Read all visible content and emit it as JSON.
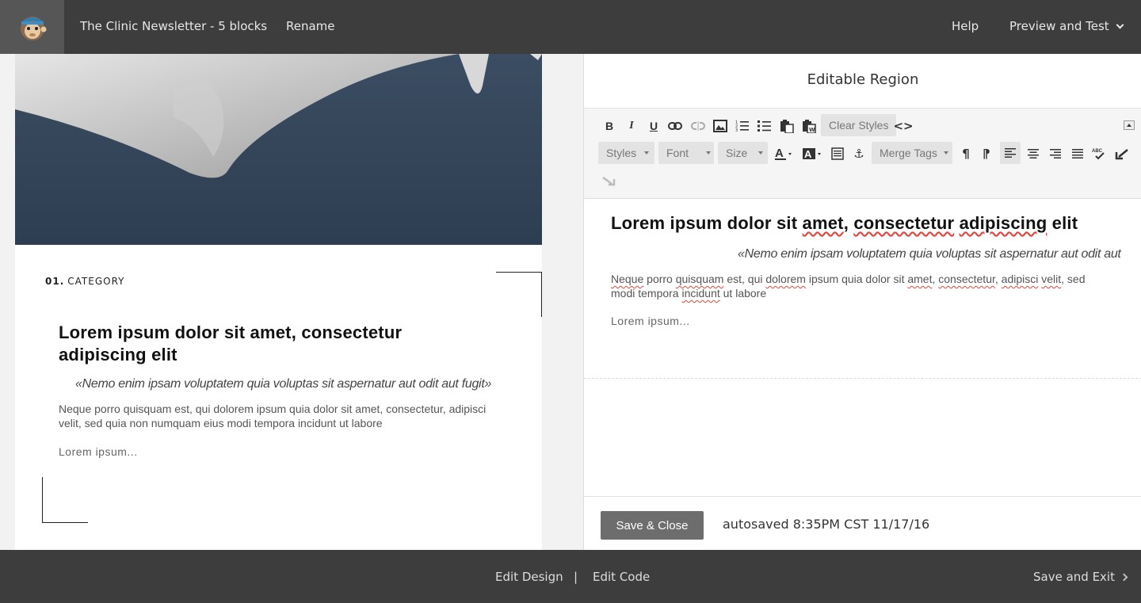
{
  "topbar": {
    "title": "The Clinic Newsletter - 5 blocks",
    "rename": "Rename",
    "help": "Help",
    "preview": "Preview and Test"
  },
  "preview": {
    "category_num": "01.",
    "category_label": "CATEGORY",
    "heading": "Lorem ipsum dolor sit amet, consectetur adipiscing elit",
    "quote": "«Nemo enim ipsam voluptatem quia voluptas sit aspernatur aut odit aut fugit»",
    "body": "Neque porro quisquam est, qui dolorem ipsum quia dolor sit amet, consectetur, adipisci velit, sed quia non numquam eius modi tempora incidunt ut labore",
    "more": "Lorem ipsum..."
  },
  "editor": {
    "title": "Editable Region",
    "toolbar": {
      "clear_styles": "Clear Styles",
      "styles": "Styles",
      "font": "Font",
      "size": "Size",
      "merge_tags": "Merge Tags"
    },
    "heading": "Lorem ipsum dolor sit amet, consectetur adipiscing elit",
    "quote": "«Nemo enim ipsam voluptatem quia voluptas sit aspernatur aut odit aut",
    "body_parts": [
      "Neque",
      " porro ",
      "quisquam",
      " est, qui ",
      "dolorem",
      " ipsum quia dolor sit ",
      "amet",
      ", ",
      "consectetur",
      ", ",
      "adipisci",
      " ",
      "velit",
      ", sed",
      "modi tempora ",
      "incidunt",
      " ut labore"
    ],
    "more": "Lorem ipsum...",
    "save_close": "Save & Close",
    "autosaved": "autosaved 8:35PM CST 11/17/16"
  },
  "bottombar": {
    "edit_design": "Edit Design",
    "separator": "|",
    "edit_code": "Edit Code",
    "save_exit": "Save and Exit"
  },
  "colors": {
    "bar_bg": "#3d3d3d",
    "button_bg": "#6d6d6d",
    "spell_underline": "#e0463f"
  }
}
